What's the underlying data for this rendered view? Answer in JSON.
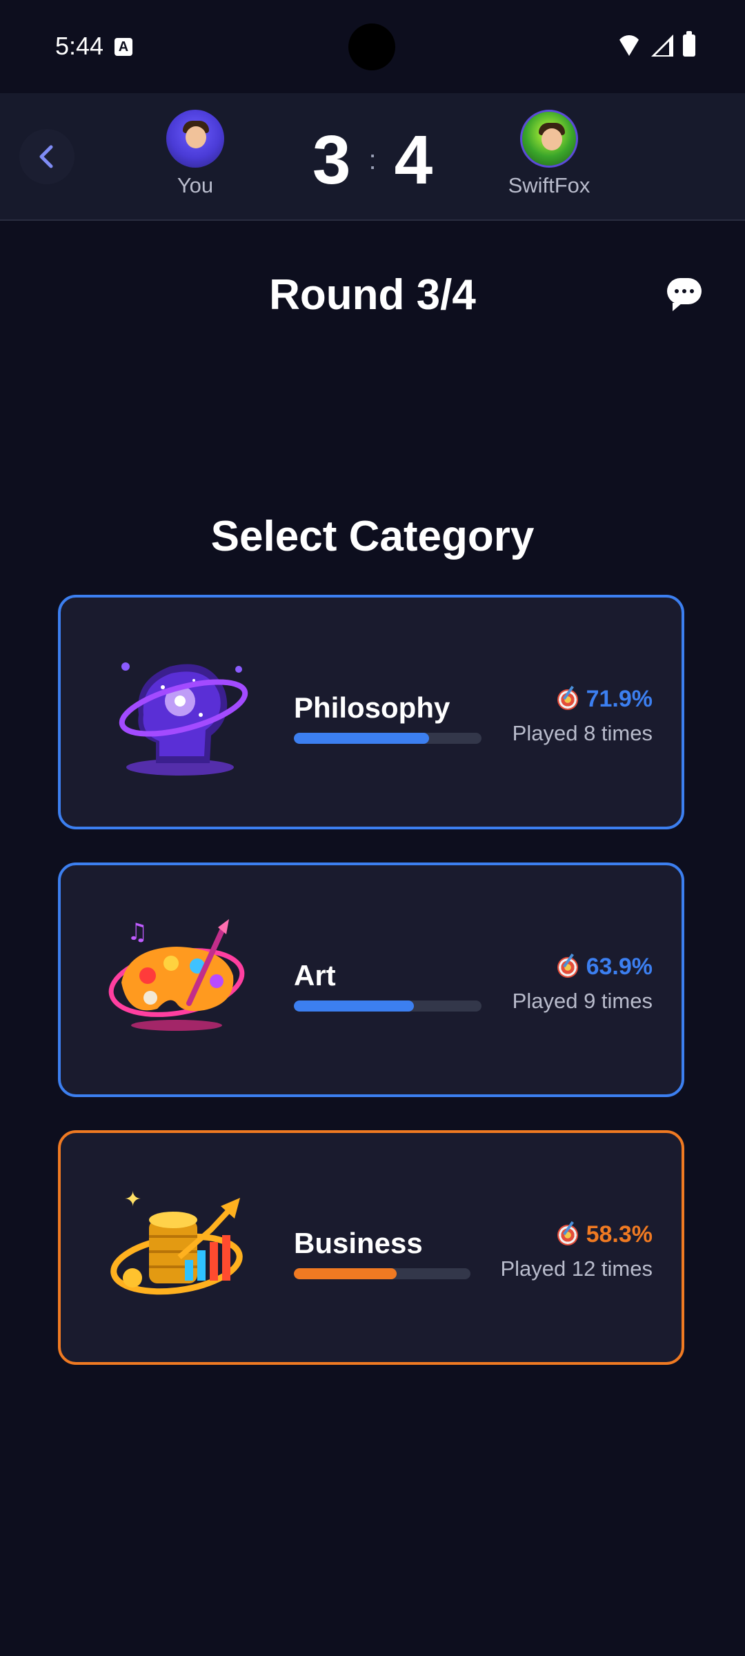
{
  "status_bar": {
    "time": "5:44",
    "keyboard_badge": "A"
  },
  "header": {
    "player_left": {
      "name": "You",
      "score": "3"
    },
    "separator": ":",
    "player_right": {
      "name": "SwiftFox",
      "score": "4"
    }
  },
  "round": {
    "label": "Round 3/4"
  },
  "section": {
    "title": "Select Category"
  },
  "categories": [
    {
      "name": "Philosophy",
      "percent": "71.9%",
      "progress": 0.719,
      "played": "Played 8 times",
      "accent": "#3c7ff0",
      "icon": "galaxy-head-icon"
    },
    {
      "name": "Art",
      "percent": "63.9%",
      "progress": 0.639,
      "played": "Played 9 times",
      "accent": "#3c7ff0",
      "icon": "art-palette-icon"
    },
    {
      "name": "Business",
      "percent": "58.3%",
      "progress": 0.583,
      "played": "Played 12 times",
      "accent": "#f07a22",
      "icon": "coins-chart-icon"
    }
  ],
  "colors": {
    "background": "#0d0e1e",
    "card": "#1a1b2e",
    "header": "#171a2c"
  }
}
